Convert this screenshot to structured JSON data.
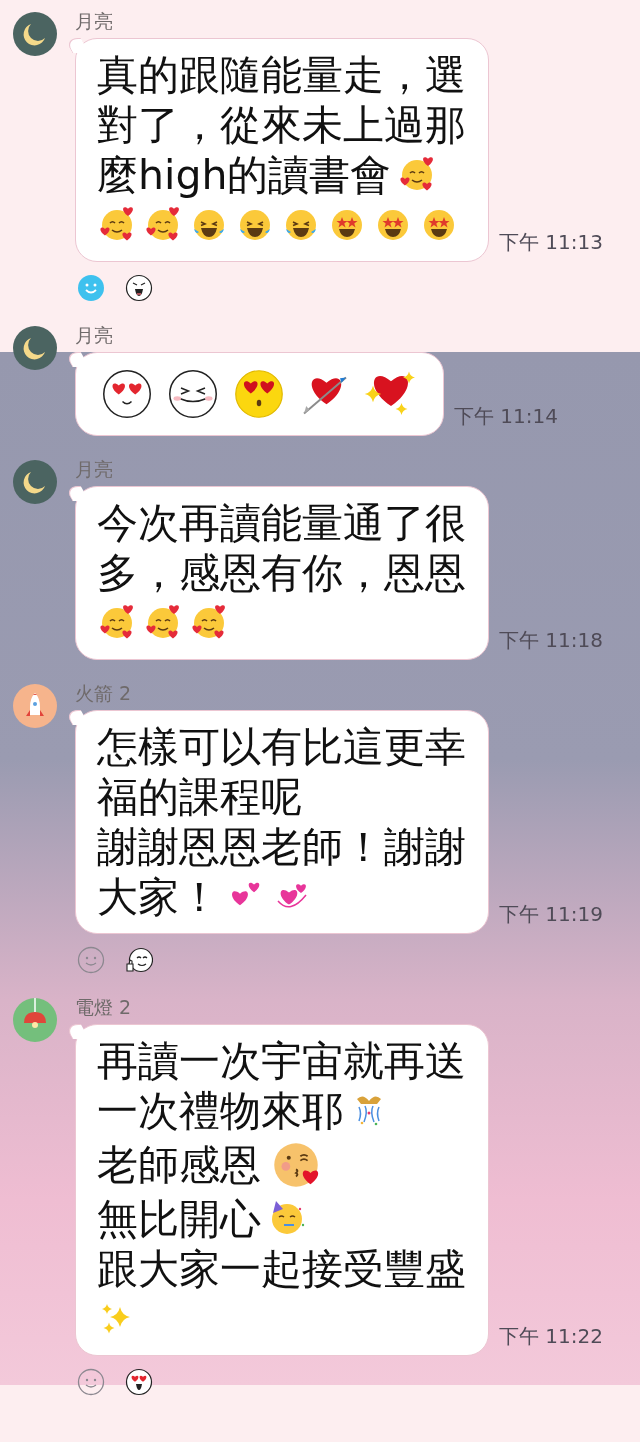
{
  "messages": [
    {
      "sender": "月亮",
      "avatar": {
        "kind": "moon"
      },
      "time": "下午 11:13",
      "reactions": [
        {
          "kind": "blue-smile"
        },
        {
          "kind": "shout-face"
        }
      ],
      "lines": [
        [
          {
            "kind": "text",
            "text": "真的跟隨能量走，選"
          }
        ],
        [
          {
            "kind": "text",
            "text": "對了，從來未上過那"
          }
        ],
        [
          {
            "kind": "text",
            "text": "麼high的讀書會"
          },
          {
            "kind": "adore"
          }
        ],
        [
          {
            "kind": "adore"
          },
          {
            "kind": "adore"
          },
          {
            "kind": "laugh"
          },
          {
            "kind": "laugh"
          },
          {
            "kind": "laugh"
          },
          {
            "kind": "starstruck"
          },
          {
            "kind": "starstruck"
          },
          {
            "kind": "starstruck"
          }
        ]
      ]
    },
    {
      "sender": "月亮",
      "avatar": {
        "kind": "moon"
      },
      "time": "下午 11:14",
      "lines": [
        [
          {
            "kind": "white-love"
          },
          {
            "kind": "white-grin"
          },
          {
            "kind": "yellow-love"
          },
          {
            "kind": "arrow-heart"
          },
          {
            "kind": "sparkle-heart"
          }
        ]
      ]
    },
    {
      "sender": "月亮",
      "avatar": {
        "kind": "moon"
      },
      "time": "下午 11:18",
      "lines": [
        [
          {
            "kind": "text",
            "text": "今次再讀能量通了很"
          }
        ],
        [
          {
            "kind": "text",
            "text": "多，感恩有你，恩恩"
          }
        ],
        [
          {
            "kind": "adore"
          },
          {
            "kind": "adore"
          },
          {
            "kind": "adore"
          }
        ]
      ]
    },
    {
      "sender": "火箭 2",
      "avatar": {
        "kind": "rocket"
      },
      "time": "下午 11:19",
      "reactions": [
        {
          "kind": "smile-outline"
        },
        {
          "kind": "thumb-face"
        }
      ],
      "lines": [
        [
          {
            "kind": "text",
            "text": "怎樣可以有比這更幸"
          }
        ],
        [
          {
            "kind": "text",
            "text": "福的課程呢"
          }
        ],
        [
          {
            "kind": "text",
            "text": "謝謝恩恩老師！謝謝"
          }
        ],
        [
          {
            "kind": "text",
            "text": "大家！"
          },
          {
            "kind": "two-hearts"
          },
          {
            "kind": "revolving-hearts"
          }
        ]
      ]
    },
    {
      "sender": "電燈 2",
      "avatar": {
        "kind": "lamp"
      },
      "time": "下午 11:22",
      "reactions": [
        {
          "kind": "smile-outline"
        },
        {
          "kind": "love-face"
        }
      ],
      "lines": [
        [
          {
            "kind": "text",
            "text": "再讀一次宇宙就再送"
          }
        ],
        [
          {
            "kind": "text",
            "text": "一次禮物來耶"
          },
          {
            "kind": "popper"
          }
        ],
        [
          {
            "kind": "text",
            "text": "老師感恩"
          },
          {
            "kind": "kiss"
          }
        ],
        [
          {
            "kind": "text",
            "text": "無比開心"
          },
          {
            "kind": "party"
          }
        ],
        [
          {
            "kind": "text",
            "text": "跟大家一起接受豐盛"
          }
        ],
        [
          {
            "kind": "sparkles"
          }
        ]
      ]
    }
  ]
}
